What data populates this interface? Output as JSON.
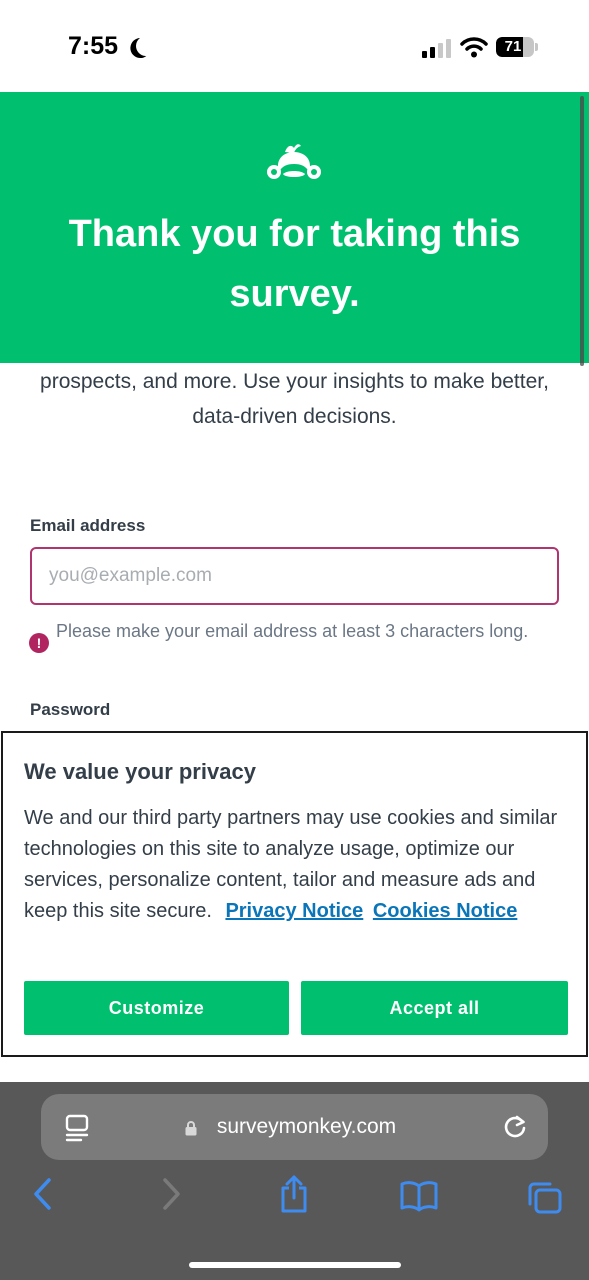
{
  "status_bar": {
    "time": "7:55",
    "battery": "71",
    "battery_level": 0.71,
    "signal_bars": 2
  },
  "header": {
    "title": "Thank you for taking this survey.",
    "logo_icon": "surveymonkey-logo-icon",
    "color": "#00bf6f"
  },
  "blurb": {
    "line": "prospects, and more. Use your insights to make better, data-driven decisions."
  },
  "form": {
    "email_label": "Email address",
    "email_placeholder": "you@example.com",
    "email_value": "",
    "email_error": "Please make your email address at least 3 characters long.",
    "password_label": "Password"
  },
  "privacy": {
    "title": "We value your privacy",
    "body": "We and our third party partners may use cookies and similar technologies on this site to analyze usage, optimize our services, personalize content, tailor and measure ads and keep this site secure.",
    "privacy_link": "Privacy Notice",
    "cookies_link": "Cookies Notice",
    "customize_label": "Customize",
    "accept_label": "Accept all"
  },
  "browser": {
    "url": "surveymonkey.com",
    "icons": [
      "reader-icon",
      "lock-icon",
      "reload-icon",
      "back-icon",
      "forward-icon",
      "share-icon",
      "bookmarks-icon",
      "tabs-icon"
    ]
  },
  "colors": {
    "brand": "#00bf6f",
    "error": "#b0255f",
    "link": "#0a75b9",
    "toolbar_blue": "#3f8cf0"
  }
}
